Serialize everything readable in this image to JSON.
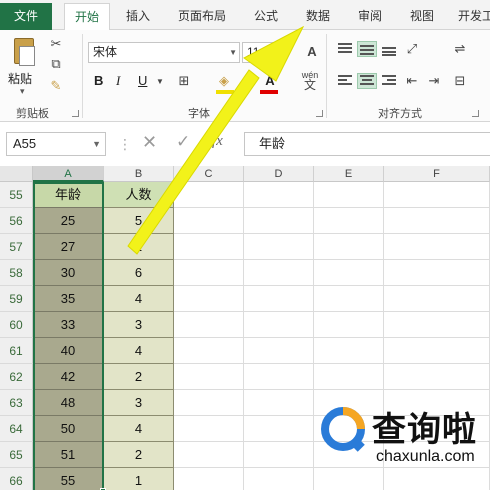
{
  "ribbon": {
    "tabs": [
      "文件",
      "开始",
      "插入",
      "页面布局",
      "公式",
      "数据",
      "审阅",
      "视图",
      "开发工"
    ],
    "active_tab": "开始",
    "clipboard": {
      "paste_label": "粘贴",
      "group_label": "剪贴板"
    },
    "font": {
      "name": "宋体",
      "size": "11",
      "group_label": "字体",
      "bold": "B",
      "italic": "I",
      "underline": "U",
      "grow": "A",
      "wen": "wén",
      "wen2": "文"
    },
    "alignment": {
      "group_label": "对齐方式"
    }
  },
  "formula_bar": {
    "name_box": "A55",
    "fx_label": "fx",
    "formula": "年龄"
  },
  "sheet": {
    "columns": [
      "A",
      "B",
      "C",
      "D",
      "E",
      "F"
    ],
    "selected_column": "A",
    "rows": [
      {
        "num": "55",
        "a": "年龄",
        "b": "人数"
      },
      {
        "num": "56",
        "a": "25",
        "b": "5"
      },
      {
        "num": "57",
        "a": "27",
        "b": "2"
      },
      {
        "num": "58",
        "a": "30",
        "b": "6"
      },
      {
        "num": "59",
        "a": "35",
        "b": "4"
      },
      {
        "num": "60",
        "a": "33",
        "b": "3"
      },
      {
        "num": "61",
        "a": "40",
        "b": "4"
      },
      {
        "num": "62",
        "a": "42",
        "b": "2"
      },
      {
        "num": "63",
        "a": "48",
        "b": "3"
      },
      {
        "num": "64",
        "a": "50",
        "b": "4"
      },
      {
        "num": "65",
        "a": "51",
        "b": "2"
      },
      {
        "num": "66",
        "a": "55",
        "b": "1"
      }
    ]
  },
  "watermark": {
    "brand": "查询啦",
    "url": "chaxunla.com"
  },
  "colors": {
    "accent": "#217346",
    "arrow": "#f2f21a",
    "watermark_blue": "#2a7bd8",
    "watermark_orange": "#f5a623"
  }
}
